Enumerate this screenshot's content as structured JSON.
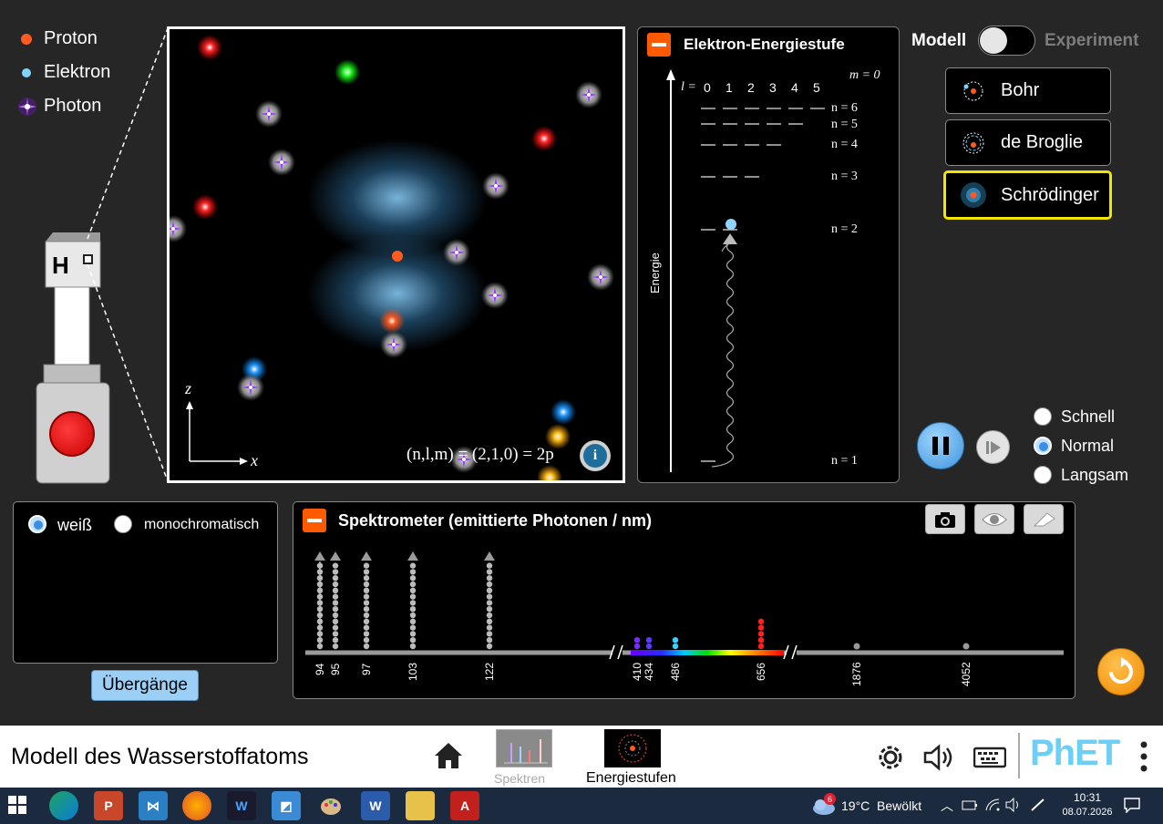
{
  "legend": {
    "proton": "Proton",
    "electron": "Elektron",
    "photon": "Photon",
    "colors": {
      "proton": "#ff5a1f",
      "electron": "#7fd3ff",
      "photon": "#9b3bff"
    }
  },
  "gun": {
    "label": "H"
  },
  "atom_view": {
    "axis_z": "z",
    "axis_x": "x",
    "state_prefix": "(n,l,m) = (2,1,0) = 2p",
    "info_icon": "info-icon"
  },
  "energy_panel": {
    "title": "Elektron-Energiestufe",
    "m_label": "m = 0",
    "l_prefix": "l =",
    "l_values": [
      "0",
      "1",
      "2",
      "3",
      "4",
      "5"
    ],
    "energy_axis": "Energie",
    "levels": [
      "n = 6",
      "n = 5",
      "n = 4",
      "n = 3",
      "n = 2",
      "n = 1"
    ]
  },
  "model_switch": {
    "left": "Modell",
    "right": "Experiment"
  },
  "models": [
    {
      "label": "Bohr"
    },
    {
      "label": "de Broglie"
    },
    {
      "label": "Schrödinger",
      "selected": true
    }
  ],
  "speed": {
    "options": [
      "Schnell",
      "Normal",
      "Langsam"
    ],
    "selected": "Normal"
  },
  "light_source": {
    "white": "weiß",
    "mono": "monochromatisch",
    "selected": "weiß",
    "transitions_button": "Übergänge"
  },
  "spectrometer": {
    "title": "Spektrometer (emittierte Photonen / nm)",
    "wavelengths": [
      "94",
      "95",
      "97",
      "103",
      "122",
      "410",
      "434",
      "486",
      "656",
      "1876",
      "4052"
    ]
  },
  "navbar": {
    "title": "Modell des Wasserstoffatoms",
    "screens": [
      {
        "label": "Spektren",
        "active": false
      },
      {
        "label": "Energiestufen",
        "active": true
      }
    ],
    "brand": "PhET"
  },
  "taskbar": {
    "weather_badge": "6",
    "weather": "19°C  Bewölkt",
    "time": "10:31",
    "date": "08.07.2026"
  }
}
